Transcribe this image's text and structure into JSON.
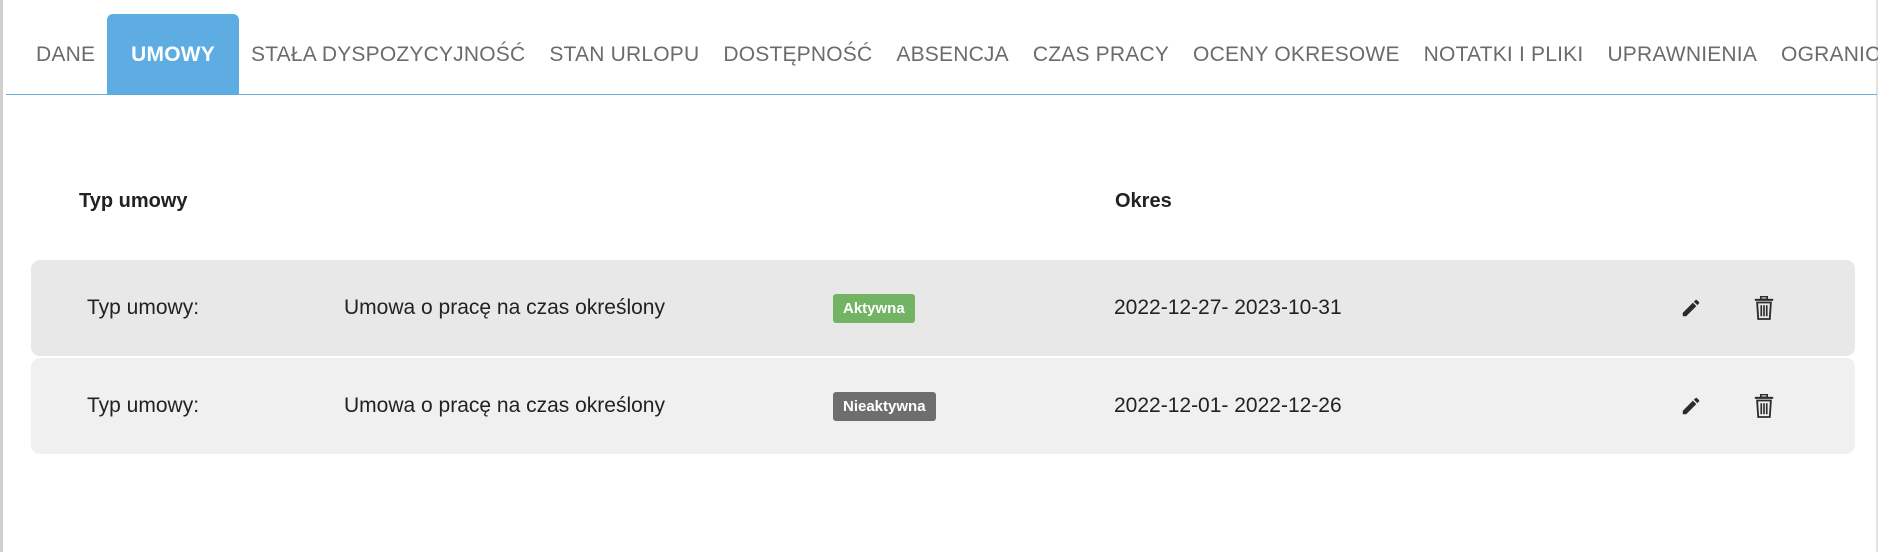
{
  "tabs": [
    {
      "label": "DANE",
      "active": false
    },
    {
      "label": "UMOWY",
      "active": true
    },
    {
      "label": "STAŁA DYSPOZYCYJNOŚĆ",
      "active": false
    },
    {
      "label": "STAN URLOPU",
      "active": false
    },
    {
      "label": "DOSTĘPNOŚĆ",
      "active": false
    },
    {
      "label": "ABSENCJA",
      "active": false
    },
    {
      "label": "CZAS PRACY",
      "active": false
    },
    {
      "label": "OCENY OKRESOWE",
      "active": false
    },
    {
      "label": "NOTATKI I PLIKI",
      "active": false
    },
    {
      "label": "UPRAWNIENIA",
      "active": false
    },
    {
      "label": "OGRANICZENIA",
      "active": false
    }
  ],
  "table": {
    "headers": {
      "type": "Typ umowy",
      "period": "Okres"
    },
    "rows": [
      {
        "type_label": "Typ umowy:",
        "type_value": "Umowa o pracę na czas określony",
        "status": "Aktywna",
        "status_color": "#72b463",
        "period": "2022-12-27- 2023-10-31",
        "edit_icon": "pencil-icon",
        "delete_icon": "trash-icon"
      },
      {
        "type_label": "Typ umowy:",
        "type_value": "Umowa o pracę na czas określony",
        "status": "Nieaktywna",
        "status_color": "#6e6e6e",
        "period": "2022-12-01- 2022-12-26",
        "edit_icon": "pencil-icon",
        "delete_icon": "trash-icon"
      }
    ]
  },
  "colors": {
    "accent": "#5dade2",
    "tab_text": "#6b6b6b",
    "row_active_bg": "#e8e8e8",
    "row_inactive_bg": "#f0f0f0"
  }
}
